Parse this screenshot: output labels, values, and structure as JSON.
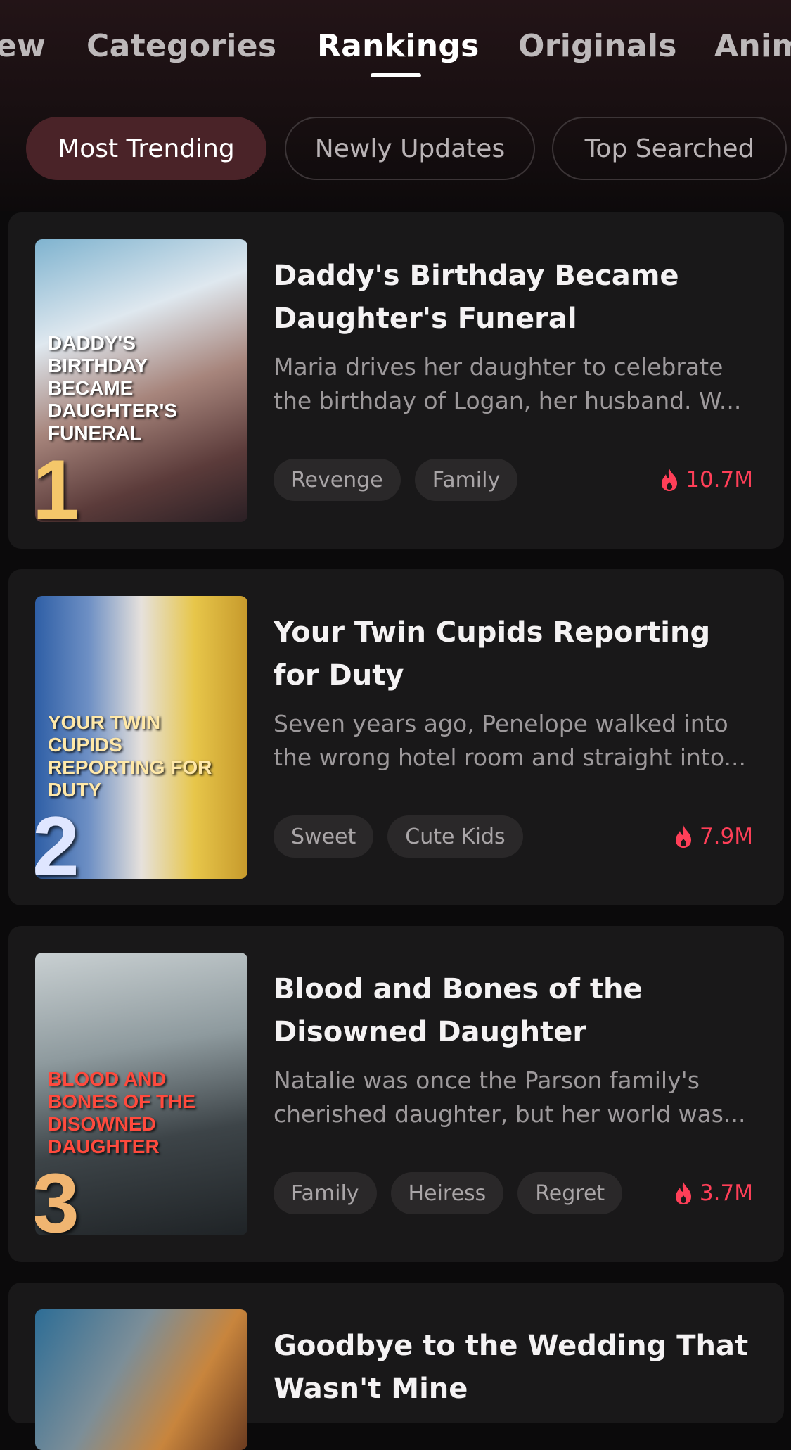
{
  "colors": {
    "accent_heat": "#ff3f58",
    "active_pill_bg": "#4a2328",
    "card_bg": "#191819",
    "page_bg": "#0b0a0b"
  },
  "nav": {
    "tabs": [
      {
        "label": "ew"
      },
      {
        "label": "Categories"
      },
      {
        "label": "Rankings",
        "active": true
      },
      {
        "label": "Originals"
      },
      {
        "label": "Anim"
      }
    ]
  },
  "filters": [
    {
      "label": "Most Trending",
      "active": true
    },
    {
      "label": "Newly Updates"
    },
    {
      "label": "Top Searched"
    }
  ],
  "items": [
    {
      "rank": "1",
      "poster_text": "Daddy's Birthday became Daughter's Funeral",
      "title": "Daddy's Birthday Became Daughter's Funeral",
      "description": "Maria drives her daughter to celebrate the birthday of Logan, her husband. W...",
      "tags": [
        "Revenge",
        "Family"
      ],
      "views": "10.7M",
      "icon": "flame-icon"
    },
    {
      "rank": "2",
      "poster_text": "Your Twin Cupids Reporting for Duty",
      "title": "Your Twin Cupids Reporting for Duty",
      "description": "Seven years ago, Penelope walked into the wrong hotel room and straight into...",
      "tags": [
        "Sweet",
        "Cute Kids"
      ],
      "views": "7.9M",
      "icon": "flame-icon"
    },
    {
      "rank": "3",
      "poster_text": "Blood and Bones of the Disowned Daughter",
      "title": "Blood and Bones of the Disowned Daughter",
      "description": "Natalie was once the Parson family's cherished daughter, but her world was...",
      "tags": [
        "Family",
        "Heiress",
        "Regret"
      ],
      "views": "3.7M",
      "icon": "flame-icon"
    },
    {
      "title": "Goodbye to the Wedding That Wasn't Mine"
    }
  ]
}
